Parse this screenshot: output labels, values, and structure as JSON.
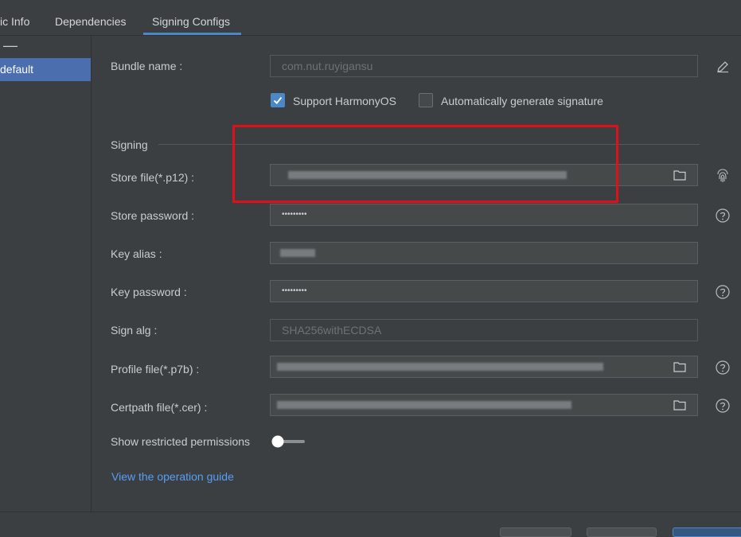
{
  "tabs": [
    "ic Info",
    "Dependencies",
    "Signing Configs"
  ],
  "active_tab": "Signing Configs",
  "left_panel": {
    "minus_glyph": "—",
    "items": [
      "default"
    ]
  },
  "bundle": {
    "label": "Bundle name :",
    "value": "com.nut.ruyigansu"
  },
  "options": {
    "support_harmony": {
      "label": "Support HarmonyOS",
      "checked": true
    },
    "auto_sign": {
      "label": "Automatically generate signature",
      "checked": false
    }
  },
  "signing": {
    "section_label": "Signing",
    "store_file_label": "Store file(*.p12) :",
    "store_password_label": "Store password :",
    "store_password_value": "•••••••••",
    "key_alias_label": "Key alias :",
    "key_password_label": "Key password :",
    "key_password_value": "•••••••••",
    "sign_alg_label": "Sign alg :",
    "sign_alg_value": "SHA256withECDSA",
    "profile_file_label": "Profile file(*.p7b) :",
    "certpath_file_label": "Certpath file(*.cer) :"
  },
  "restricted": {
    "label": "Show restricted permissions",
    "enabled": false
  },
  "guide_link": "View the operation guide",
  "colors": {
    "accent": "#4a88c7",
    "selection": "#4b6eaf",
    "highlight_box": "#e0101a",
    "link": "#589df6"
  },
  "icons": [
    "edit-icon",
    "folder-icon",
    "fingerprint-icon",
    "help-icon",
    "check-icon"
  ]
}
